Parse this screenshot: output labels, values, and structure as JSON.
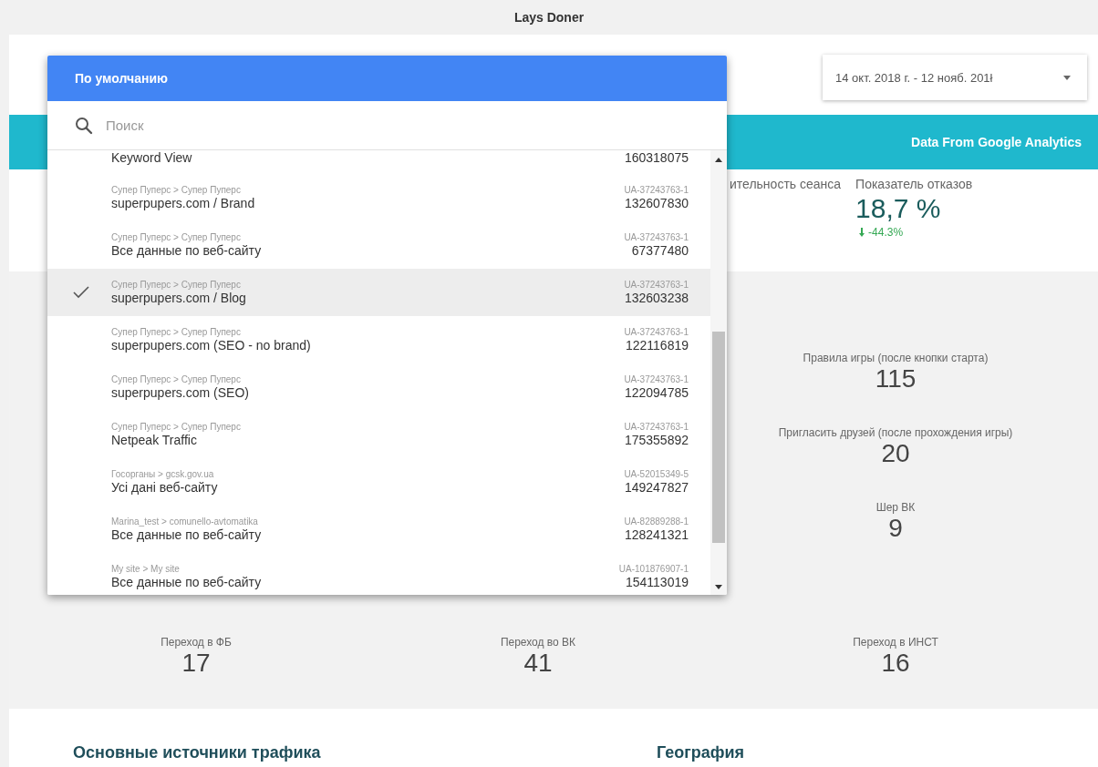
{
  "report": {
    "title": "Lays Doner"
  },
  "date_range": {
    "value": "14 окт. 2018 г. - 12 нояб. 201ł"
  },
  "banner": {
    "text": "Data From Google Analytics"
  },
  "top_metrics": [
    {
      "label": "ительность сеанса"
    },
    {
      "label": "Показатель отказов",
      "value": "18,7 %",
      "delta": "-44.3%"
    }
  ],
  "side_metrics": [
    {
      "label": "Правила игры (после кнопки старта)",
      "value": "115"
    },
    {
      "label": "Пригласить друзей (после прохождения игры)",
      "value": "20"
    },
    {
      "label": "Шер ВК",
      "value": "9"
    }
  ],
  "bottom_metrics": [
    {
      "label": "Переход в ФБ",
      "value": "17"
    },
    {
      "label": "Переход во ВК",
      "value": "41"
    },
    {
      "label": "Переход в ИНСТ",
      "value": "16"
    }
  ],
  "sections": [
    {
      "title": "Основные источники трафика"
    },
    {
      "title": "География"
    }
  ],
  "view_picker": {
    "header": "По умолчанию",
    "search": {
      "placeholder": "Поиск"
    },
    "items": [
      {
        "name": "Keyword View",
        "view_id": "160318075",
        "selected": false
      },
      {
        "path": "Супер Пуперс > Супер Пуперс",
        "name": "superpupers.com / Brand",
        "account_id": "UA-37243763-1",
        "view_id": "132607830",
        "selected": false
      },
      {
        "path": "Супер Пуперс > Супер Пуперс",
        "name": "Все данные по веб-сайту",
        "account_id": "UA-37243763-1",
        "view_id": "67377480",
        "selected": false
      },
      {
        "path": "Супер Пуперс > Супер Пуперс",
        "name": "superpupers.com / Blog",
        "account_id": "UA-37243763-1",
        "view_id": "132603238",
        "selected": true
      },
      {
        "path": "Супер Пуперс > Супер Пуперс",
        "name": "superpupers.com (SEO - no brand)",
        "account_id": "UA-37243763-1",
        "view_id": "122116819",
        "selected": false
      },
      {
        "path": "Супер Пуперс > Супер Пуперс",
        "name": "superpupers.com (SEO)",
        "account_id": "UA-37243763-1",
        "view_id": "122094785",
        "selected": false
      },
      {
        "path": "Супер Пуперс > Супер Пуперс",
        "name": "Netpeak Traffic",
        "account_id": "UA-37243763-1",
        "view_id": "175355892",
        "selected": false
      },
      {
        "path": "Госорганы > gcsk.gov.ua",
        "name": "Усі дані веб-сайту",
        "account_id": "UA-52015349-5",
        "view_id": "149247827",
        "selected": false
      },
      {
        "path": "Marina_test > comunello-avtomatika",
        "name": "Все данные по веб-сайту",
        "account_id": "UA-82889288-1",
        "view_id": "128241321",
        "selected": false
      },
      {
        "path": "My site > My site",
        "name": "Все данные по веб-сайту",
        "account_id": "UA-101876907-1",
        "view_id": "154113019",
        "selected": false
      }
    ]
  }
}
